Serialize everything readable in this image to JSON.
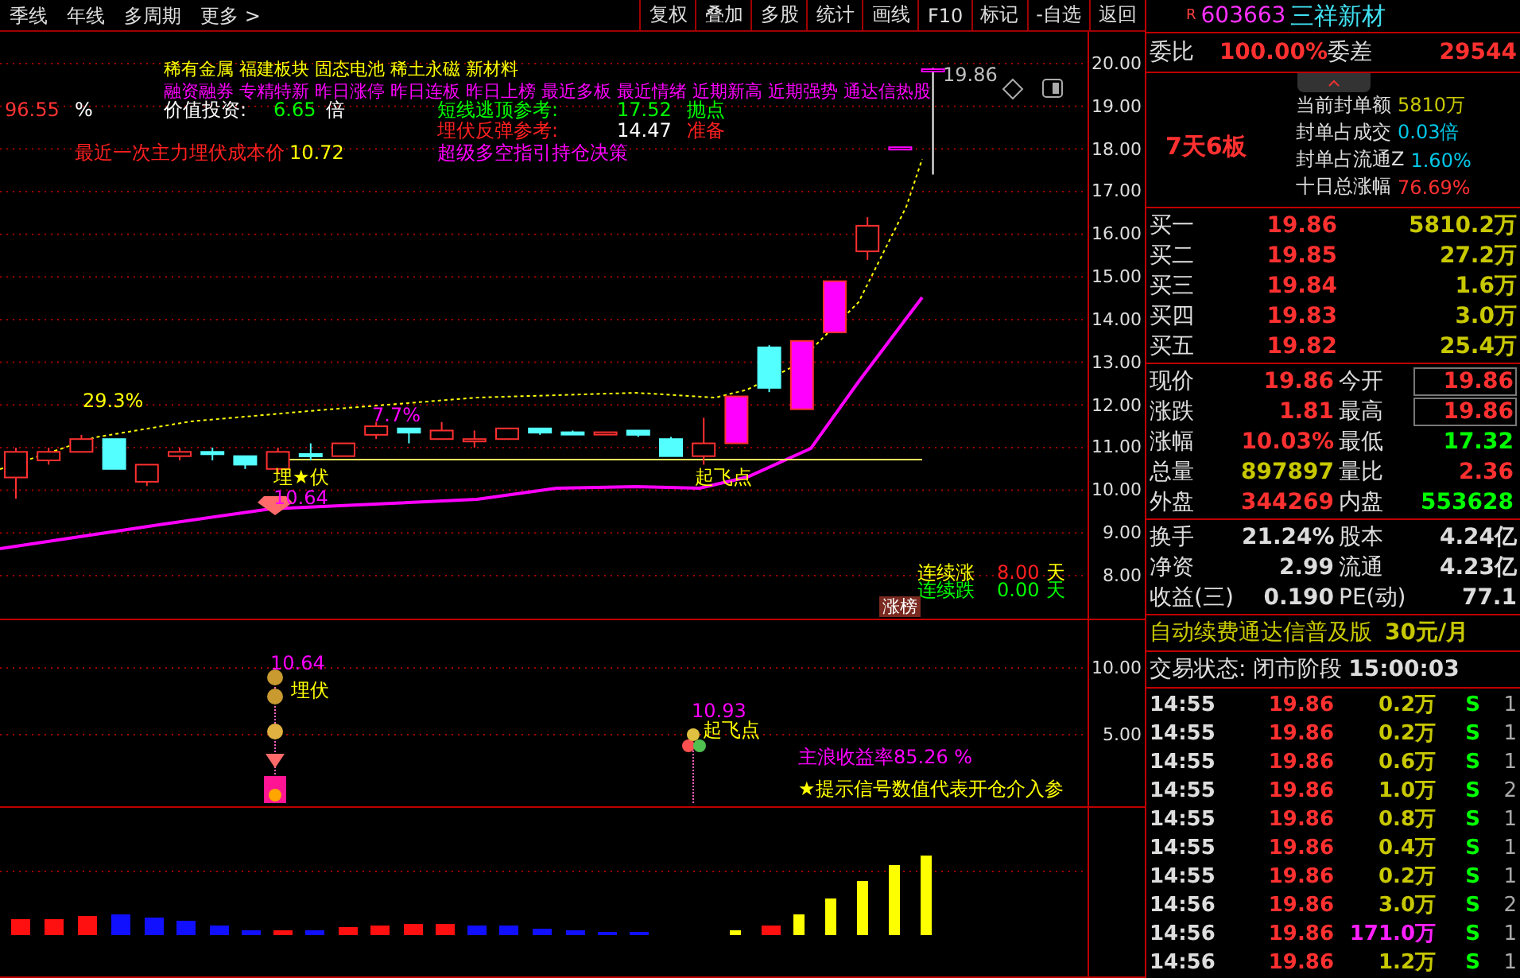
{
  "toolbar": {
    "period_tabs": [
      "季线",
      "年线",
      "多周期",
      "更多 >"
    ],
    "buttons": [
      "复权",
      "叠加",
      "多股",
      "统计",
      "画线",
      "F10",
      "标记",
      "-自选",
      "返回"
    ]
  },
  "main_chart": {
    "axis_labels": [
      "20.00",
      "19.00",
      "18.00",
      "17.00",
      "16.00",
      "15.00",
      "14.00",
      "13.00",
      "12.00",
      "11.00",
      "10.00",
      "9.00",
      "8.00"
    ],
    "annotations": [
      {
        "text": "稀有金属  福建板块  固态电池 稀土永磁 新材料",
        "color": "#ffff00"
      },
      {
        "text": "融资融券 专精特新 昨日涨停 昨日连板 昨日上榜 最近多板 最近情绪 近期新高 近期强势 通达信热股",
        "color": "#ff00ff"
      },
      {
        "text": "96.55",
        "color": "#ff3333"
      },
      {
        "text": "%",
        "color": "#ffffff"
      },
      {
        "text": "价值投资:",
        "color": "#ffffff"
      },
      {
        "text": "6.65",
        "color": "#00ff00"
      },
      {
        "text": "倍",
        "color": "#ffffff"
      },
      {
        "text": "短线逃顶参考:",
        "color": "#00ff00"
      },
      {
        "text": "17.52",
        "color": "#00ff00"
      },
      {
        "text": "抛点",
        "color": "#00ff00"
      },
      {
        "text": "埋伏反弹参考:",
        "color": "#ff2020"
      },
      {
        "text": "14.47",
        "color": "#ffffff"
      },
      {
        "text": "准备",
        "color": "#ff2020"
      },
      {
        "text": "最近一次主力埋伏成本价",
        "color": "#ff2020"
      },
      {
        "text": "10.72",
        "color": "#ffff00"
      },
      {
        "text": "超级多空指引持仓决策",
        "color": "#ff00ff"
      },
      {
        "text": "19.86",
        "color": "#c0c0c0"
      },
      {
        "text": "29.3%",
        "color": "#ffff00"
      },
      {
        "text": "7.7%",
        "color": "#ff00ff"
      },
      {
        "text": "埋★伏",
        "color": "#ffff00"
      },
      {
        "text": "10.64",
        "color": "#ff00ff"
      },
      {
        "text": "起飞点",
        "color": "#ffff00"
      },
      {
        "text": "连续涨",
        "color": "#ffff00"
      },
      {
        "text": "8.00",
        "color": "#ff2020"
      },
      {
        "text": "天",
        "color": "#ffff00"
      },
      {
        "text": "连续跌",
        "color": "#00ff00"
      },
      {
        "text": "0.00",
        "color": "#00ff00"
      },
      {
        "text": "天",
        "color": "#00ff00"
      }
    ],
    "badge": "涨榜"
  },
  "signal_chart": {
    "axis_labels": [
      "10.00",
      "5.00"
    ],
    "annotations": [
      {
        "text": "10.64",
        "color": "#ff00ff"
      },
      {
        "text": "埋伏",
        "color": "#ffff00"
      },
      {
        "text": "10.93",
        "color": "#ff00ff"
      },
      {
        "text": "起飞点",
        "color": "#ffff00"
      },
      {
        "text": "主浪收益率85.26 %",
        "color": "#ff00ff"
      },
      {
        "text": "★提示信号数值代表开仓介入参",
        "color": "#ffff00"
      }
    ]
  },
  "quote_panel": {
    "flag": "R",
    "code": "603663",
    "name": "三祥新材",
    "order_ratio": {
      "label": "委比",
      "value": "100.00%",
      "diff_label": "委差",
      "diff": "29544"
    },
    "limit_streak": "7天6板",
    "seal_info": [
      {
        "label": "当前封单额",
        "value": "5810万",
        "color": "#c8c800"
      },
      {
        "label": "封单占成交",
        "value": "0.03倍",
        "color": "#00c8e8"
      },
      {
        "label": "封单占流通Z",
        "value": "1.60%",
        "color": "#00c8e8"
      },
      {
        "label": "十日总涨幅",
        "value": "76.69%",
        "color": "#ff3030"
      }
    ],
    "bids": [
      {
        "label": "买一",
        "price": "19.86",
        "volume": "5810.2万"
      },
      {
        "label": "买二",
        "price": "19.85",
        "volume": "27.2万"
      },
      {
        "label": "买三",
        "price": "19.84",
        "volume": "1.6万"
      },
      {
        "label": "买四",
        "price": "19.83",
        "volume": "3.0万"
      },
      {
        "label": "买五",
        "price": "19.82",
        "volume": "25.4万"
      }
    ],
    "quotes": [
      {
        "left": {
          "label": "现价",
          "value": "19.86",
          "color": "#ff3030"
        },
        "right": {
          "label": "今开",
          "value": "19.86",
          "color": "#ff3030",
          "boxed": true
        }
      },
      {
        "left": {
          "label": "涨跌",
          "value": "1.81",
          "color": "#ff3030"
        },
        "right": {
          "label": "最高",
          "value": "19.86",
          "color": "#ff3030",
          "boxed": true
        }
      },
      {
        "left": {
          "label": "涨幅",
          "value": "10.03%",
          "color": "#ff3030"
        },
        "right": {
          "label": "最低",
          "value": "17.32",
          "color": "#00ff00",
          "boxed": false
        }
      },
      {
        "left": {
          "label": "总量",
          "value": "897897",
          "color": "#c8c800"
        },
        "right": {
          "label": "量比",
          "value": "2.36",
          "color": "#ff3030",
          "boxed": false
        }
      },
      {
        "left": {
          "label": "外盘",
          "value": "344269",
          "color": "#ff3030"
        },
        "right": {
          "label": "内盘",
          "value": "553628",
          "color": "#00ff00",
          "boxed": false
        }
      }
    ],
    "fundamentals": [
      {
        "label": "换手",
        "value": "21.24%",
        "label2": "股本",
        "value2": "4.24亿"
      },
      {
        "label": "净资",
        "value": "2.99",
        "label2": "流通",
        "value2": "4.23亿"
      },
      {
        "label": "收益(三)",
        "value": "0.190",
        "label2": "PE(动)",
        "value2": "77.1"
      }
    ],
    "promo": {
      "text": "自动续费通达信普及版",
      "price": "30元/月"
    },
    "status": {
      "label": "交易状态: 闭市阶段",
      "time": "15:00:03"
    },
    "ticks": [
      {
        "time": "14:55",
        "price": "19.86",
        "volume": "0.2万",
        "big": false,
        "side": "S",
        "count": "1"
      },
      {
        "time": "14:55",
        "price": "19.86",
        "volume": "0.2万",
        "big": false,
        "side": "S",
        "count": "1"
      },
      {
        "time": "14:55",
        "price": "19.86",
        "volume": "0.6万",
        "big": false,
        "side": "S",
        "count": "1"
      },
      {
        "time": "14:55",
        "price": "19.86",
        "volume": "1.0万",
        "big": false,
        "side": "S",
        "count": "2"
      },
      {
        "time": "14:55",
        "price": "19.86",
        "volume": "0.8万",
        "big": false,
        "side": "S",
        "count": "1"
      },
      {
        "time": "14:55",
        "price": "19.86",
        "volume": "0.4万",
        "big": false,
        "side": "S",
        "count": "1"
      },
      {
        "time": "14:55",
        "price": "19.86",
        "volume": "0.2万",
        "big": false,
        "side": "S",
        "count": "1"
      },
      {
        "time": "14:56",
        "price": "19.86",
        "volume": "3.0万",
        "big": false,
        "side": "S",
        "count": "2"
      },
      {
        "time": "14:56",
        "price": "19.86",
        "volume": "171.0万",
        "big": true,
        "side": "S",
        "count": "1"
      },
      {
        "time": "14:56",
        "price": "19.86",
        "volume": "1.2万",
        "big": false,
        "side": "S",
        "count": "1"
      }
    ]
  }
}
